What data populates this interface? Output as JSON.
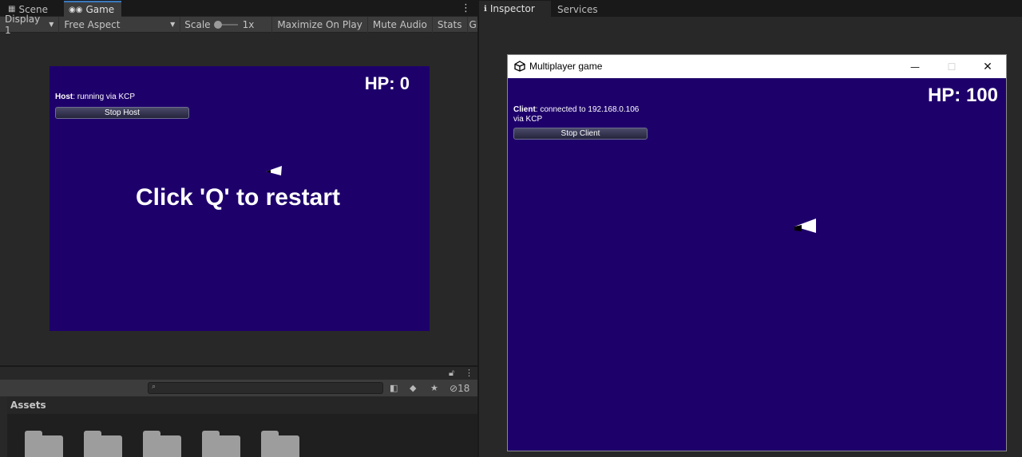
{
  "editor": {
    "tabs": [
      {
        "label": "Scene",
        "icon": "grid-icon"
      },
      {
        "label": "Game",
        "icon": "gamepad-icon"
      }
    ],
    "right_tabs": [
      {
        "label": "Inspector",
        "icon": "info-icon"
      },
      {
        "label": "Services"
      }
    ],
    "game_toolbar": {
      "display": "Display 1",
      "aspect": "Free Aspect",
      "scale_label": "Scale",
      "scale_value": "1x",
      "scale_fraction": 0.0,
      "maximize": "Maximize On Play",
      "mute": "Mute Audio",
      "stats": "Stats",
      "gizmos": "Gi"
    },
    "project": {
      "assets_label": "Assets",
      "hidden_count": "18",
      "folder_count": 5
    }
  },
  "host_view": {
    "hp": "HP: 0",
    "status_bold": "Host",
    "status_text": ": running via KCP",
    "button": "Stop Host",
    "restart": "Click 'Q' to restart"
  },
  "client_window": {
    "title": "Multiplayer game",
    "hp": "HP: 100",
    "status_bold": "Client",
    "status_line1": ": connected to 192.168.0.106",
    "status_line2": "via KCP",
    "button": "Stop Client"
  },
  "colors": {
    "game_bg": "#1e006b",
    "editor_bg": "#282828",
    "tab_accent": "#3a79bb"
  }
}
